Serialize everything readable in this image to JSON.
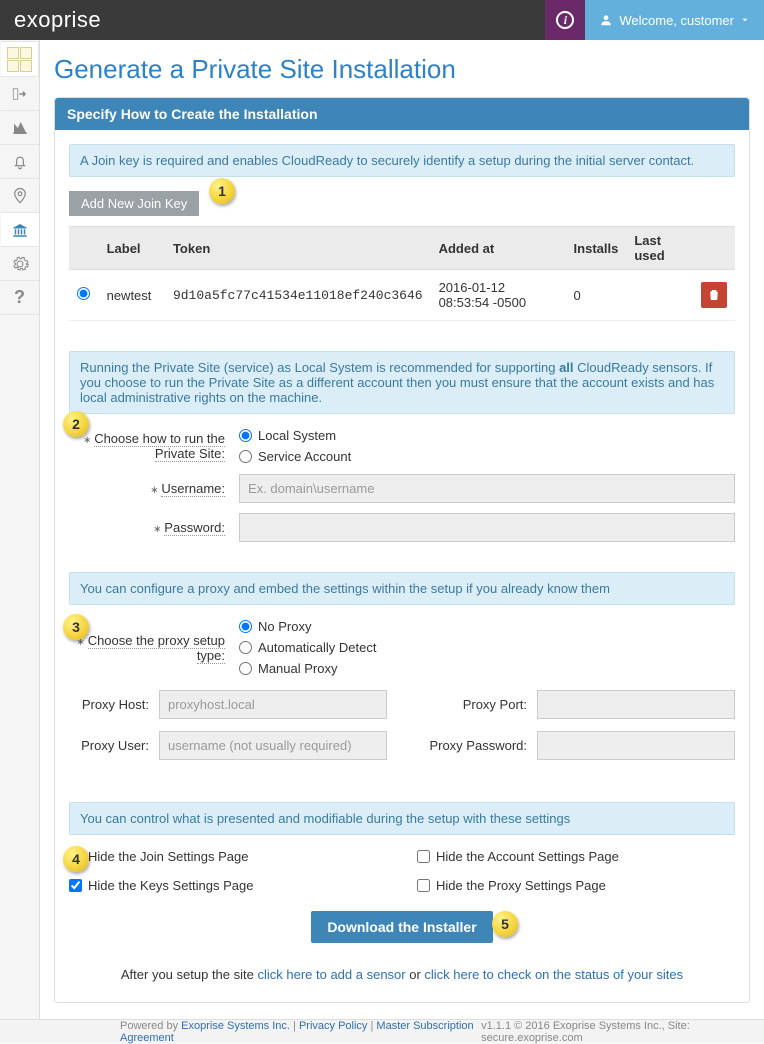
{
  "brand": "exoprise",
  "welcome_prefix": "Welcome, ",
  "welcome_user": "customer",
  "page_title": "Generate a Private Site Installation",
  "panel_header": "Specify How to Create the Installation",
  "info_joinkey": "A Join key is required and enables CloudReady to securely identify a setup during the initial server contact.",
  "btn_add_join": "Add New Join Key",
  "join_table": {
    "headers": {
      "label": "Label",
      "token": "Token",
      "added": "Added at",
      "installs": "Installs",
      "lastused": "Last used"
    },
    "row": {
      "label": "newtest",
      "token": "9d10a5fc77c41534e11018ef240c3646",
      "added": "2016-01-12 08:53:54 -0500",
      "installs": "0",
      "lastused": ""
    }
  },
  "info_runas_pre": "Running the Private Site (service) as Local System is recommended for supporting ",
  "info_runas_bold": "all",
  "info_runas_post": " CloudReady sensors. If you choose to run the Private Site as a different account then you must ensure that the account exists and has local administrative rights on the machine.",
  "lbl_runas": "Choose how to run the Private Site:",
  "radio_local": "Local System",
  "radio_service": "Service Account",
  "lbl_username": "Username:",
  "ph_username": "Ex. domain\\username",
  "lbl_password": "Password:",
  "info_proxy": "You can configure a proxy and embed the settings within the setup if you already know them",
  "lbl_proxytype": "Choose the proxy setup type:",
  "radio_noproxy": "No Proxy",
  "radio_autodetect": "Automatically Detect",
  "radio_manual": "Manual Proxy",
  "lbl_proxyhost": "Proxy Host:",
  "ph_proxyhost": "proxyhost.local",
  "lbl_proxyport": "Proxy Port:",
  "lbl_proxyuser": "Proxy User:",
  "ph_proxyuser": "username (not usually required)",
  "lbl_proxypass": "Proxy Password:",
  "info_hide": "You can control what is presented and modifiable during the setup with these settings",
  "chk_hidejoin": "Hide the Join Settings Page",
  "chk_hideaccount": "Hide the Account Settings Page",
  "chk_hidekeys": "Hide the Keys Settings Page",
  "chk_hideproxy": "Hide the Proxy Settings Page",
  "btn_download": "Download the Installer",
  "after_pre": "After you setup the site ",
  "after_link1": "click here to add a sensor",
  "after_mid": " or ",
  "after_link2": "click here to check on the status of your sites",
  "footer": {
    "powered": "Powered by ",
    "company": "Exoprise Systems Inc.",
    "privacy": "Privacy Policy",
    "msa": "Master Subscription Agreement",
    "version": "v1.1.1 © 2016 Exoprise Systems Inc., Site: secure.exoprise.com"
  },
  "callouts": {
    "c1": "1",
    "c2": "2",
    "c3": "3",
    "c4": "4",
    "c5": "5"
  }
}
